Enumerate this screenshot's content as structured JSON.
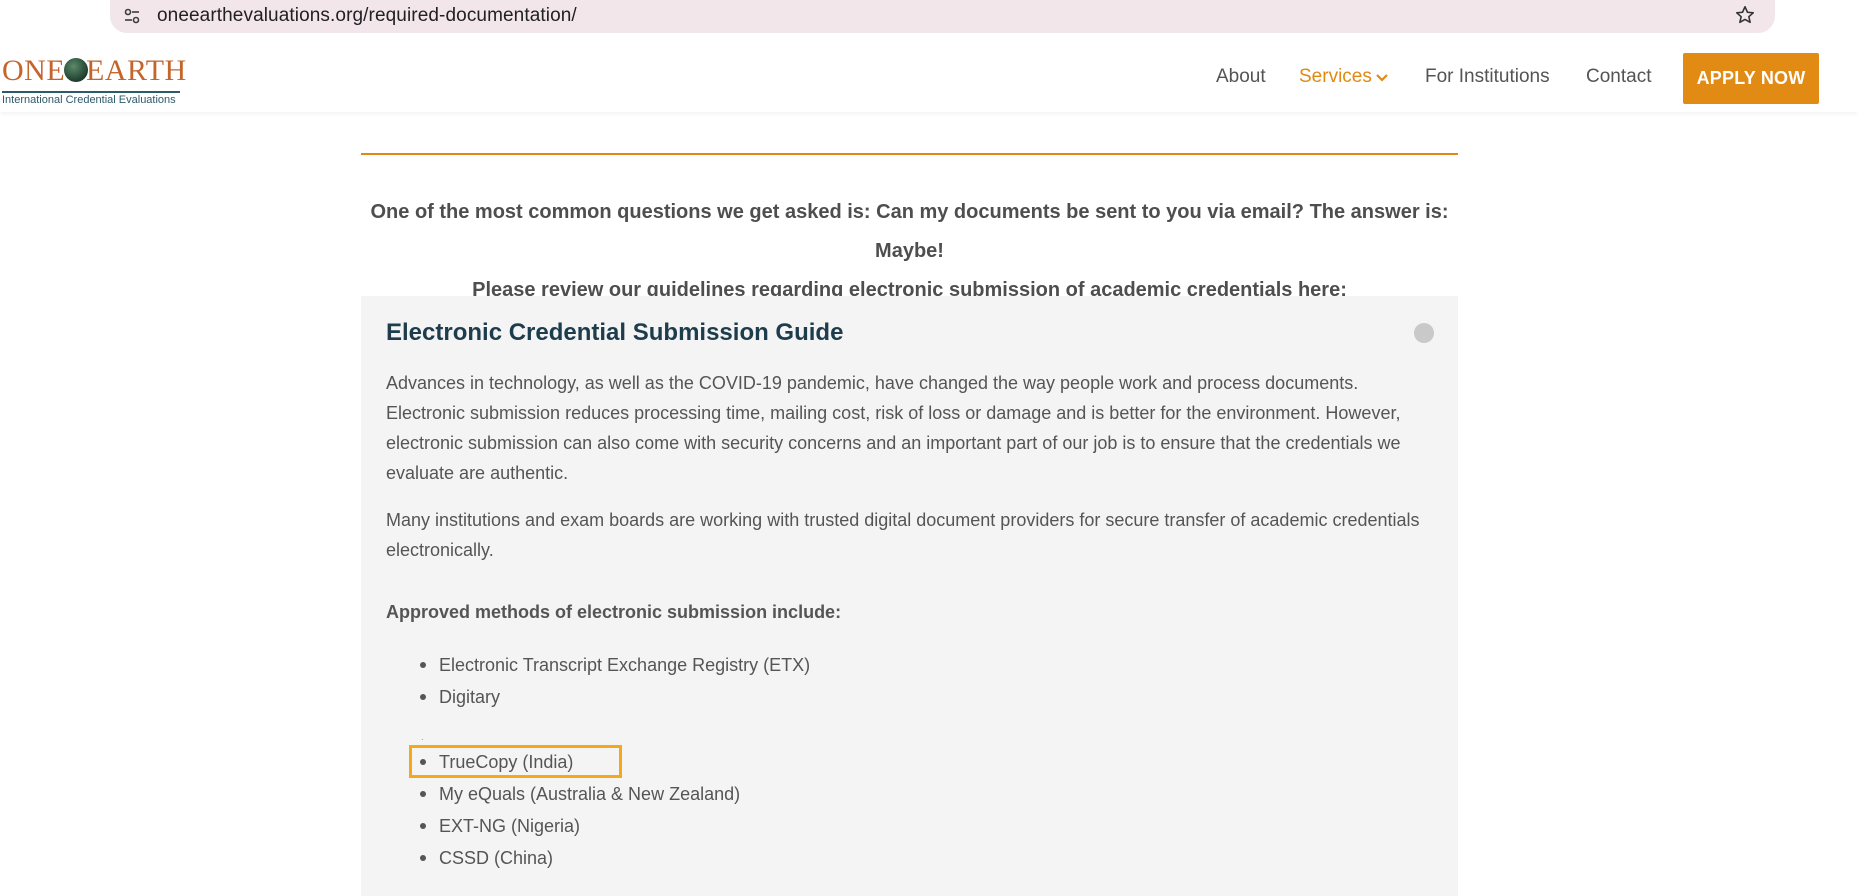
{
  "browser": {
    "url": "oneearthevaluations.org/required-documentation/"
  },
  "logo": {
    "word_one": "ONE",
    "word_earth": "EARTH",
    "tagline": "International Credential Evaluations"
  },
  "nav": {
    "items": [
      {
        "label": "About"
      },
      {
        "label": "Services"
      },
      {
        "label": "For Institutions"
      },
      {
        "label": "Contact"
      }
    ],
    "cta_label": "APPLY NOW"
  },
  "intro": {
    "line1": "One of the most common questions we get asked is: Can my documents be sent to you via email? The answer is: Maybe!",
    "line2": "Please review our guidelines regarding electronic submission of academic credentials here:"
  },
  "accordion": {
    "title": "Electronic Credential Submission Guide",
    "paragraphs": [
      "Advances in technology, as well as the COVID-19 pandemic, have changed the way people work and process documents. Electronic submission reduces processing time, mailing cost, risk of loss or damage and is better for the environment. However, electronic submission can also come with security concerns and an important part of our job is to ensure that the credentials we evaluate are authentic.",
      "Many institutions and exam boards are working with trusted digital document providers for secure transfer of academic credentials electronically."
    ],
    "methods_heading": "Approved methods of electronic submission include:",
    "methods": [
      "Electronic Transcript Exchange Registry (ETX)",
      "Digitary",
      "",
      "TrueCopy (India)",
      "My eQuals (Australia & New Zealand)",
      "EXT-NG (Nigeria)",
      "CSSD (China)"
    ]
  },
  "colors": {
    "accent": "#e08a14",
    "highlight": "#f6a81b",
    "heading": "#1d3c4c"
  }
}
